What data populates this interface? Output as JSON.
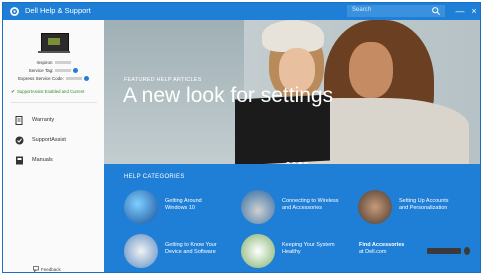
{
  "titlebar": {
    "title": "Dell Help & Support",
    "search_placeholder": "Search",
    "minimize": "—",
    "close": "×"
  },
  "sidebar": {
    "model_label": "Inspiron",
    "service_tag_label": "Service Tag:",
    "express_code_label": "Express Service Code:",
    "status": "SupportAssist Enabled and Current",
    "nav": [
      {
        "label": "Warranty",
        "icon": "warranty-icon"
      },
      {
        "label": "SupportAssist",
        "icon": "supportassist-icon"
      },
      {
        "label": "Manuals",
        "icon": "manual-icon"
      }
    ],
    "feedback": "Feedback"
  },
  "hero": {
    "featured_label": "FEATURED HELP ARTICLES",
    "title": "A new look for settings",
    "slides": 4,
    "active_slide": 3
  },
  "help": {
    "title": "HELP CATEGORIES",
    "categories": [
      {
        "line1": "Getting Around",
        "line2": "Windows 10"
      },
      {
        "line1": "Connecting to Wireless",
        "line2": "and Accessories"
      },
      {
        "line1": "Setting Up Accounts",
        "line2": "and Personalization"
      },
      {
        "line1": "Getting to Know Your",
        "line2": "Device and Software"
      },
      {
        "line1": "Keeping Your System",
        "line2": "Healthy"
      },
      {
        "line1": "Find Accessories",
        "line2": "at Dell.com"
      }
    ]
  },
  "colors": {
    "accent": "#1f7fd6",
    "status_green": "#2e8b2e"
  }
}
